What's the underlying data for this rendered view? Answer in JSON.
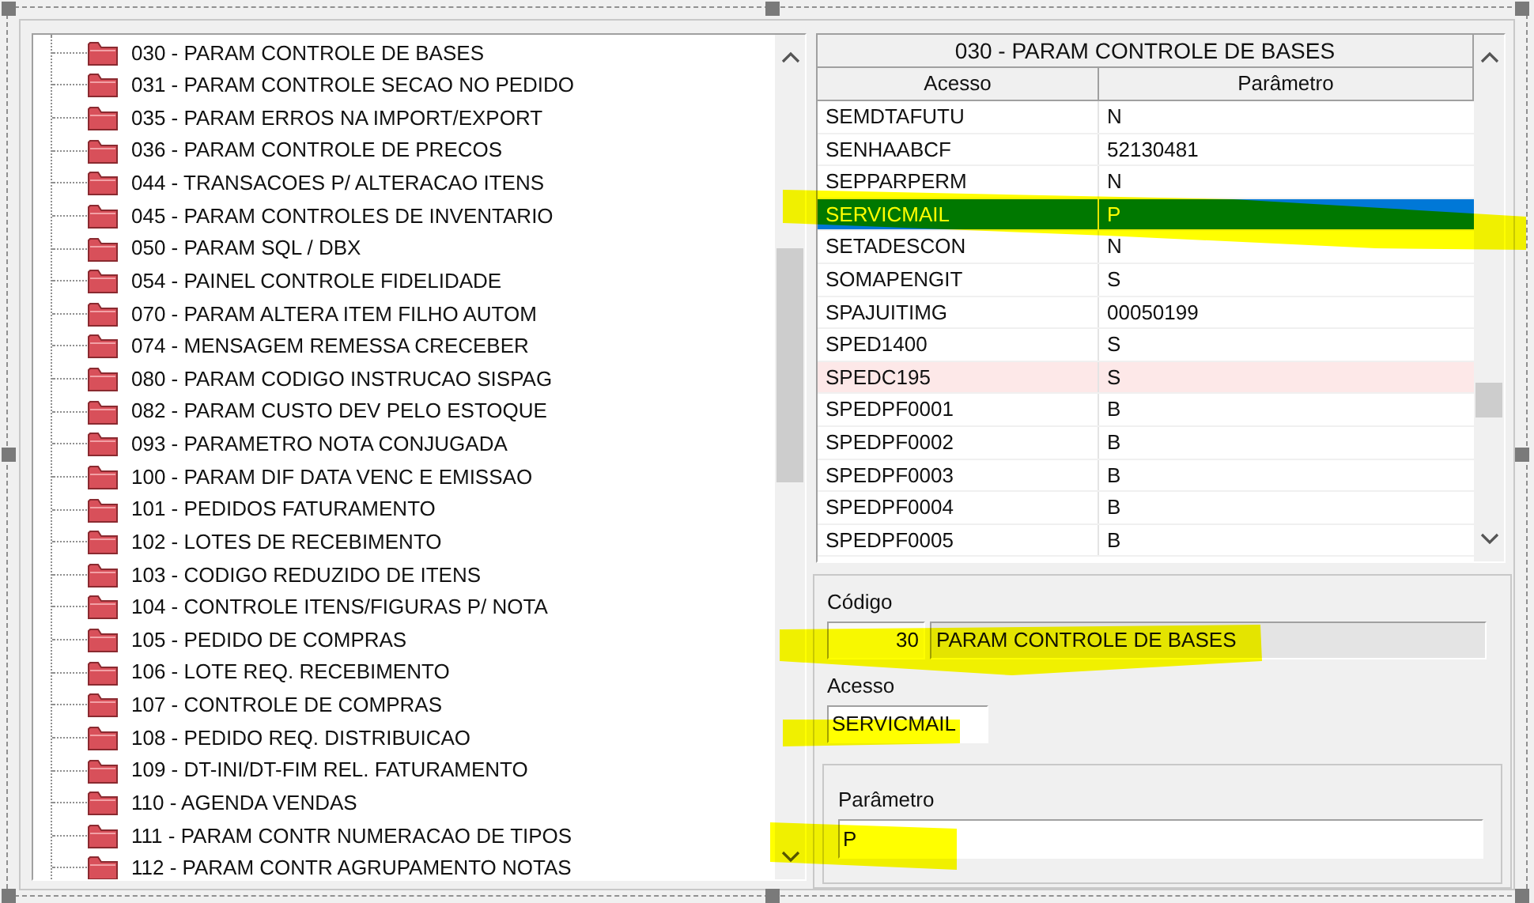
{
  "tree": {
    "items": [
      {
        "label": "030 - PARAM CONTROLE DE BASES"
      },
      {
        "label": "031 - PARAM CONTROLE SECAO NO PEDIDO"
      },
      {
        "label": "035 - PARAM ERROS NA IMPORT/EXPORT"
      },
      {
        "label": "036 - PARAM CONTROLE DE PRECOS"
      },
      {
        "label": "044 - TRANSACOES P/ ALTERACAO ITENS"
      },
      {
        "label": "045 - PARAM CONTROLES DE INVENTARIO"
      },
      {
        "label": "050 - PARAM SQL / DBX"
      },
      {
        "label": "054 - PAINEL CONTROLE FIDELIDADE"
      },
      {
        "label": "070 - PARAM ALTERA ITEM FILHO AUTOM"
      },
      {
        "label": "074 - MENSAGEM REMESSA CRECEBER"
      },
      {
        "label": "080 - PARAM CODIGO INSTRUCAO SISPAG"
      },
      {
        "label": "082 - PARAM CUSTO DEV PELO ESTOQUE"
      },
      {
        "label": "093 - PARAMETRO NOTA CONJUGADA"
      },
      {
        "label": "100 - PARAM DIF DATA VENC E EMISSAO"
      },
      {
        "label": "101 - PEDIDOS FATURAMENTO"
      },
      {
        "label": "102 - LOTES DE RECEBIMENTO"
      },
      {
        "label": "103 - CODIGO REDUZIDO DE ITENS"
      },
      {
        "label": "104 - CONTROLE ITENS/FIGURAS P/ NOTA"
      },
      {
        "label": "105 - PEDIDO DE COMPRAS"
      },
      {
        "label": "106 - LOTE REQ. RECEBIMENTO"
      },
      {
        "label": "107 - CONTROLE DE COMPRAS"
      },
      {
        "label": "108 - PEDIDO REQ. DISTRIBUICAO"
      },
      {
        "label": "109 - DT-INI/DT-FIM REL. FATURAMENTO"
      },
      {
        "label": "110 - AGENDA VENDAS"
      },
      {
        "label": "111 - PARAM CONTR NUMERACAO DE TIPOS"
      },
      {
        "label": "112 - PARAM CONTR AGRUPAMENTO NOTAS"
      }
    ]
  },
  "grid": {
    "title": "030 - PARAM CONTROLE DE BASES",
    "columns": [
      "Acesso",
      "Parâmetro"
    ],
    "rows": [
      {
        "access": "SEMDTAFUTU",
        "parameter": "N",
        "selected": false,
        "marked": false
      },
      {
        "access": "SENHAABCF",
        "parameter": "52130481",
        "selected": false,
        "marked": false
      },
      {
        "access": "SEPPARPERM",
        "parameter": "N",
        "selected": false,
        "marked": false
      },
      {
        "access": "SERVICMAIL",
        "parameter": "P",
        "selected": true,
        "marked": false
      },
      {
        "access": "SETADESCON",
        "parameter": "N",
        "selected": false,
        "marked": false
      },
      {
        "access": "SOMAPENGIT",
        "parameter": "S",
        "selected": false,
        "marked": false
      },
      {
        "access": "SPAJUITIMG",
        "parameter": "00050199",
        "selected": false,
        "marked": false
      },
      {
        "access": "SPED1400",
        "parameter": "S",
        "selected": false,
        "marked": false
      },
      {
        "access": "SPEDC195",
        "parameter": "S",
        "selected": false,
        "marked": true
      },
      {
        "access": "SPEDPF0001",
        "parameter": "B",
        "selected": false,
        "marked": false
      },
      {
        "access": "SPEDPF0002",
        "parameter": "B",
        "selected": false,
        "marked": false
      },
      {
        "access": "SPEDPF0003",
        "parameter": "B",
        "selected": false,
        "marked": false
      },
      {
        "access": "SPEDPF0004",
        "parameter": "B",
        "selected": false,
        "marked": false
      },
      {
        "access": "SPEDPF0005",
        "parameter": "B",
        "selected": false,
        "marked": false
      }
    ]
  },
  "form": {
    "codigo_label": "Código",
    "codigo": "30",
    "descricao": "PARAM CONTROLE DE BASES",
    "acesso_label": "Acesso",
    "acesso": "SERVICMAIL",
    "parametro_label": "Parâmetro",
    "parametro": "P"
  }
}
